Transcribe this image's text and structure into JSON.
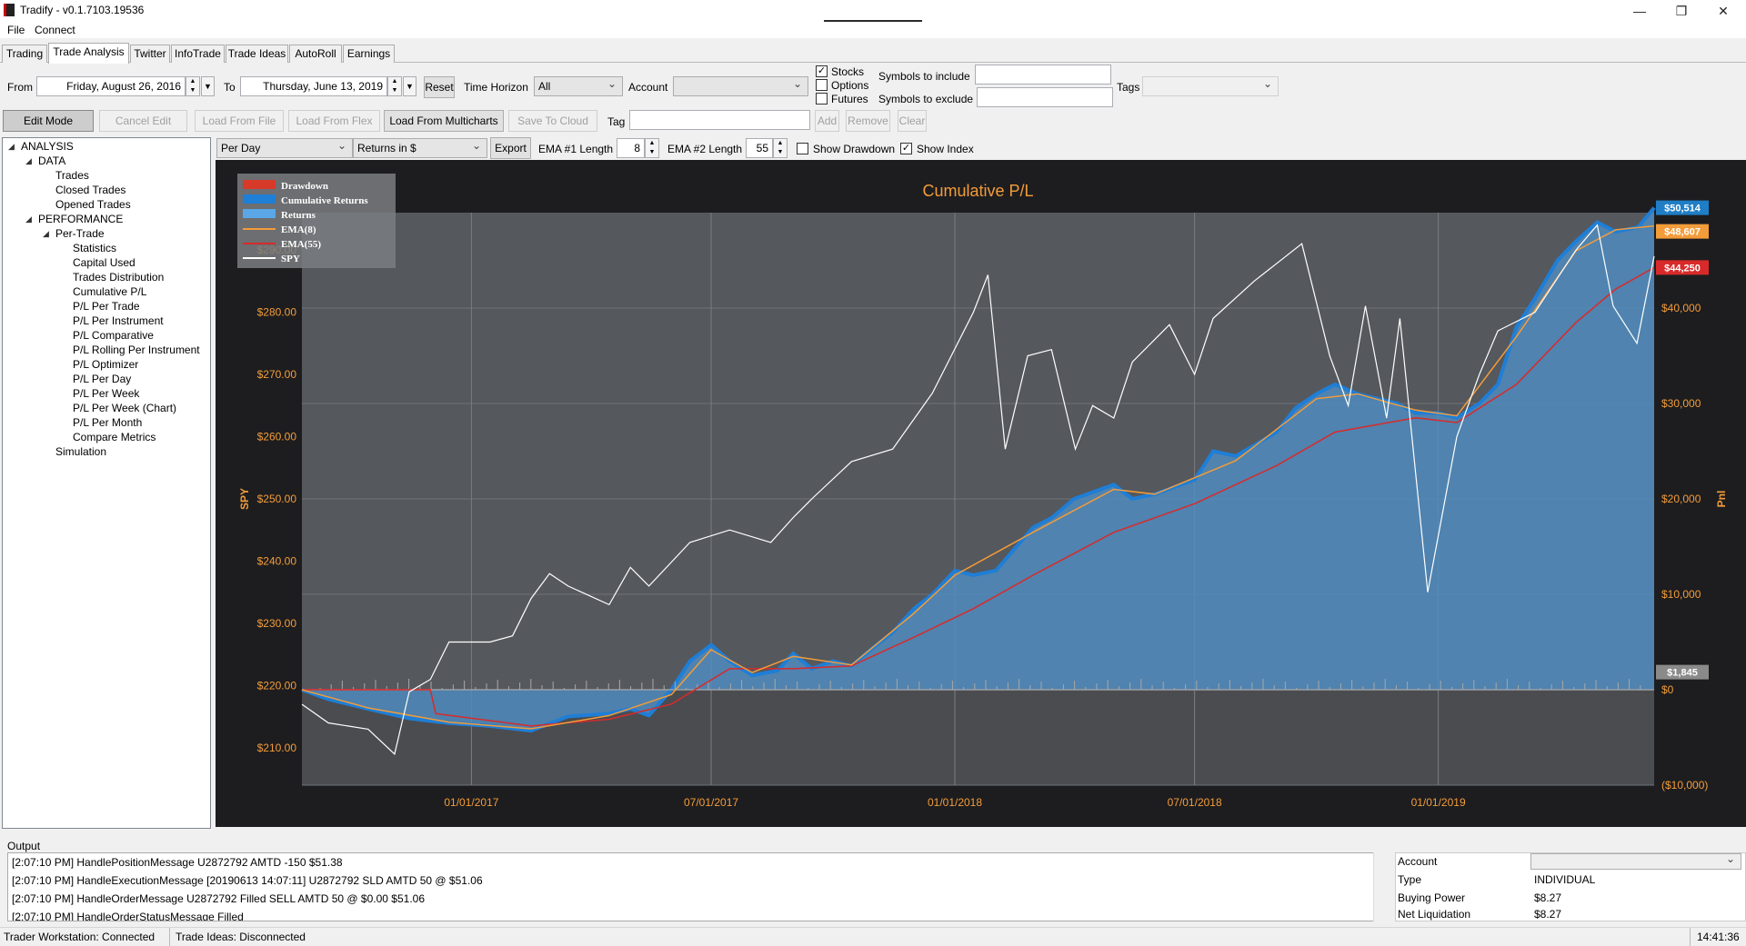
{
  "window": {
    "title": "Tradify - v0.1.7103.19536",
    "minimize": "—",
    "maximize": "❐",
    "close": "✕"
  },
  "menu": [
    "File",
    "Connect"
  ],
  "tabs": [
    "Trading",
    "Trade Analysis",
    "Twitter",
    "InfoTrade",
    "Trade Ideas",
    "AutoRoll",
    "Earnings"
  ],
  "filters": {
    "from_label": "From",
    "from_value": "Friday, August 26, 2016",
    "to_label": "To",
    "to_value": "Thursday, June 13, 2019",
    "reset_label": "Reset",
    "time_horizon_label": "Time Horizon",
    "time_horizon_value": "All",
    "account_label": "Account",
    "account_value": "",
    "stocks_label": "Stocks",
    "options_label": "Options",
    "futures_label": "Futures",
    "stocks_checked": true,
    "options_checked": false,
    "futures_checked": false,
    "include_label": "Symbols to include",
    "exclude_label": "Symbols to exclude",
    "include_value": "",
    "exclude_value": "",
    "tags_label": "Tags",
    "tags_value": ""
  },
  "toolbar": {
    "edit_mode": "Edit Mode",
    "cancel_edit": "Cancel Edit",
    "load_file": "Load From File",
    "load_flex": "Load From Flex",
    "load_multicharts": "Load From Multicharts",
    "save_cloud": "Save To Cloud",
    "tag_label": "Tag",
    "tag_value": "",
    "add": "Add",
    "remove": "Remove",
    "clear": "Clear"
  },
  "chart_options": {
    "period": "Per Day",
    "returns_mode": "Returns in $",
    "export": "Export",
    "ema1_label": "EMA #1 Length",
    "ema1_value": "8",
    "ema2_label": "EMA #2 Length",
    "ema2_value": "55",
    "show_drawdown_label": "Show Drawdown",
    "show_drawdown": false,
    "show_index_label": "Show Index",
    "show_index": true
  },
  "tree": [
    {
      "label": "ANALYSIS",
      "level": 0,
      "expanded": true
    },
    {
      "label": "DATA",
      "level": 1,
      "expanded": true
    },
    {
      "label": "Trades",
      "level": 2
    },
    {
      "label": "Closed Trades",
      "level": 2
    },
    {
      "label": "Opened Trades",
      "level": 2
    },
    {
      "label": "PERFORMANCE",
      "level": 1,
      "expanded": true
    },
    {
      "label": "Per-Trade",
      "level": 2,
      "expanded": true
    },
    {
      "label": "Statistics",
      "level": 3
    },
    {
      "label": "Capital Used",
      "level": 3
    },
    {
      "label": "Trades Distribution",
      "level": 3
    },
    {
      "label": "Cumulative P/L",
      "level": 3
    },
    {
      "label": "P/L Per Trade",
      "level": 3
    },
    {
      "label": "P/L Per Instrument",
      "level": 3
    },
    {
      "label": "P/L Comparative",
      "level": 3
    },
    {
      "label": "P/L Rolling Per Instrument",
      "level": 3
    },
    {
      "label": "P/L Optimizer",
      "level": 3
    },
    {
      "label": "P/L Per Day",
      "level": 3
    },
    {
      "label": "P/L Per Week",
      "level": 3
    },
    {
      "label": "P/L Per Week (Chart)",
      "level": 3
    },
    {
      "label": "P/L Per Month",
      "level": 3
    },
    {
      "label": "Compare Metrics",
      "level": 3
    },
    {
      "label": "Simulation",
      "level": 2
    }
  ],
  "chart_data": {
    "type": "area",
    "title": "Cumulative P/L",
    "ylabel_left": "SPY",
    "ylabel_right": "Pnl",
    "x_tick_labels": [
      "01/01/2017",
      "07/01/2017",
      "01/01/2018",
      "07/01/2018",
      "01/01/2019"
    ],
    "x_range": [
      "2016-08-26",
      "2019-06-13"
    ],
    "y_left_ticks": [
      "$210.00",
      "$220.00",
      "$230.00",
      "$240.00",
      "$250.00",
      "$260.00",
      "$270.00",
      "$280.00",
      "$290.00"
    ],
    "y_left_range": [
      204,
      296
    ],
    "y_right_ticks": [
      "($10,000)",
      "$0",
      "$10,000",
      "$20,000",
      "$30,000",
      "$40,000"
    ],
    "y_right_range": [
      -10000,
      50000
    ],
    "legend": [
      "Drawdown",
      "Cumulative Returns",
      "Returns",
      "EMA(8)",
      "EMA(55)",
      "SPY"
    ],
    "legend_position": "top-left",
    "last_value_labels": [
      {
        "text": "$50,514",
        "color": "#1f7ec6"
      },
      {
        "text": "$48,607",
        "color": "#f39c3a"
      },
      {
        "text": "$44,250",
        "color": "#d82a2a"
      },
      {
        "text": "$1,845",
        "color": "#8a8a8a"
      }
    ],
    "series": [
      {
        "name": "Cumulative Returns",
        "color": "#3d8fd6",
        "points": [
          [
            "2016-08-26",
            0
          ],
          [
            "2016-09-15",
            -1000
          ],
          [
            "2016-10-15",
            -2000
          ],
          [
            "2016-11-15",
            -3000
          ],
          [
            "2016-12-15",
            -3500
          ],
          [
            "2017-01-15",
            -3800
          ],
          [
            "2017-02-15",
            -4300
          ],
          [
            "2017-03-15",
            -2800
          ],
          [
            "2017-04-15",
            -2500
          ],
          [
            "2017-05-01",
            -2000
          ],
          [
            "2017-05-15",
            -2700
          ],
          [
            "2017-06-01",
            0
          ],
          [
            "2017-06-15",
            3000
          ],
          [
            "2017-07-01",
            4700
          ],
          [
            "2017-07-15",
            3000
          ],
          [
            "2017-08-01",
            1500
          ],
          [
            "2017-08-20",
            2000
          ],
          [
            "2017-09-01",
            3800
          ],
          [
            "2017-09-15",
            2200
          ],
          [
            "2017-10-01",
            3000
          ],
          [
            "2017-10-15",
            2500
          ],
          [
            "2017-11-01",
            4500
          ],
          [
            "2017-11-15",
            6000
          ],
          [
            "2017-12-01",
            8500
          ],
          [
            "2017-12-15",
            10000
          ],
          [
            "2018-01-01",
            12500
          ],
          [
            "2018-01-15",
            12000
          ],
          [
            "2018-02-01",
            12500
          ],
          [
            "2018-03-01",
            17000
          ],
          [
            "2018-03-15",
            18000
          ],
          [
            "2018-04-01",
            20000
          ],
          [
            "2018-05-01",
            21500
          ],
          [
            "2018-05-15",
            20000
          ],
          [
            "2018-06-01",
            20500
          ],
          [
            "2018-07-01",
            22000
          ],
          [
            "2018-07-15",
            25000
          ],
          [
            "2018-08-01",
            24500
          ],
          [
            "2018-09-01",
            27000
          ],
          [
            "2018-09-15",
            29500
          ],
          [
            "2018-10-01",
            31000
          ],
          [
            "2018-10-15",
            32000
          ],
          [
            "2018-11-01",
            31000
          ],
          [
            "2018-12-01",
            30000
          ],
          [
            "2018-12-15",
            29000
          ],
          [
            "2019-01-01",
            29000
          ],
          [
            "2019-01-15",
            28500
          ],
          [
            "2019-02-01",
            30000
          ],
          [
            "2019-02-15",
            32000
          ],
          [
            "2019-03-01",
            38000
          ],
          [
            "2019-03-15",
            41000
          ],
          [
            "2019-04-01",
            45000
          ],
          [
            "2019-04-15",
            47000
          ],
          [
            "2019-05-01",
            49000
          ],
          [
            "2019-05-15",
            48000
          ],
          [
            "2019-06-01",
            48500
          ],
          [
            "2019-06-13",
            50514
          ]
        ]
      },
      {
        "name": "EMA(8)",
        "color": "#f39c3a",
        "points": [
          [
            "2016-08-26",
            0
          ],
          [
            "2016-10-15",
            -1900
          ],
          [
            "2016-12-15",
            -3400
          ],
          [
            "2017-02-15",
            -4100
          ],
          [
            "2017-04-15",
            -2700
          ],
          [
            "2017-06-01",
            -500
          ],
          [
            "2017-07-01",
            4200
          ],
          [
            "2017-08-01",
            1800
          ],
          [
            "2017-09-01",
            3500
          ],
          [
            "2017-10-15",
            2600
          ],
          [
            "2017-12-01",
            8000
          ],
          [
            "2018-01-01",
            12000
          ],
          [
            "2018-03-01",
            16500
          ],
          [
            "2018-05-01",
            21000
          ],
          [
            "2018-06-01",
            20500
          ],
          [
            "2018-08-01",
            24000
          ],
          [
            "2018-10-01",
            30500
          ],
          [
            "2018-11-01",
            31000
          ],
          [
            "2018-12-15",
            29300
          ],
          [
            "2019-01-15",
            28700
          ],
          [
            "2019-03-01",
            37000
          ],
          [
            "2019-04-15",
            46000
          ],
          [
            "2019-05-15",
            48200
          ],
          [
            "2019-06-13",
            48607
          ]
        ]
      },
      {
        "name": "EMA(55)",
        "color": "#d82a2a",
        "points": [
          [
            "2016-08-26",
            0
          ],
          [
            "2016-12-01",
            0
          ],
          [
            "2016-12-05",
            -2500
          ],
          [
            "2017-02-15",
            -3800
          ],
          [
            "2017-04-15",
            -3100
          ],
          [
            "2017-06-01",
            -1500
          ],
          [
            "2017-07-15",
            2200
          ],
          [
            "2017-09-01",
            2200
          ],
          [
            "2017-10-15",
            2500
          ],
          [
            "2017-12-01",
            5500
          ],
          [
            "2018-01-15",
            8500
          ],
          [
            "2018-03-01",
            12000
          ],
          [
            "2018-05-01",
            16500
          ],
          [
            "2018-07-01",
            19500
          ],
          [
            "2018-09-01",
            23500
          ],
          [
            "2018-10-15",
            27000
          ],
          [
            "2018-12-15",
            28500
          ],
          [
            "2019-01-15",
            28000
          ],
          [
            "2019-03-01",
            32000
          ],
          [
            "2019-04-15",
            38500
          ],
          [
            "2019-05-15",
            42000
          ],
          [
            "2019-06-13",
            44250
          ]
        ]
      },
      {
        "name": "SPY",
        "color": "#ffffff",
        "points": [
          [
            "2016-08-26",
            217
          ],
          [
            "2016-09-15",
            214
          ],
          [
            "2016-10-15",
            213
          ],
          [
            "2016-11-04",
            209
          ],
          [
            "2016-11-15",
            219
          ],
          [
            "2016-12-01",
            221
          ],
          [
            "2016-12-15",
            227
          ],
          [
            "2017-01-15",
            227
          ],
          [
            "2017-02-01",
            228
          ],
          [
            "2017-02-15",
            234
          ],
          [
            "2017-03-01",
            238
          ],
          [
            "2017-03-15",
            236
          ],
          [
            "2017-04-15",
            233
          ],
          [
            "2017-05-01",
            239
          ],
          [
            "2017-05-15",
            236
          ],
          [
            "2017-06-15",
            243
          ],
          [
            "2017-07-15",
            245
          ],
          [
            "2017-08-15",
            243
          ],
          [
            "2017-09-01",
            247
          ],
          [
            "2017-09-15",
            250
          ],
          [
            "2017-10-15",
            256
          ],
          [
            "2017-11-15",
            258
          ],
          [
            "2017-12-15",
            267
          ],
          [
            "2018-01-15",
            280
          ],
          [
            "2018-01-26",
            286
          ],
          [
            "2018-02-08",
            258
          ],
          [
            "2018-02-25",
            273
          ],
          [
            "2018-03-15",
            274
          ],
          [
            "2018-04-02",
            258
          ],
          [
            "2018-04-15",
            265
          ],
          [
            "2018-05-01",
            263
          ],
          [
            "2018-05-15",
            272
          ],
          [
            "2018-06-12",
            278
          ],
          [
            "2018-07-01",
            270
          ],
          [
            "2018-07-15",
            279
          ],
          [
            "2018-08-15",
            285
          ],
          [
            "2018-09-20",
            291
          ],
          [
            "2018-10-11",
            273
          ],
          [
            "2018-10-25",
            265
          ],
          [
            "2018-11-07",
            281
          ],
          [
            "2018-11-23",
            263
          ],
          [
            "2018-12-03",
            279
          ],
          [
            "2018-12-24",
            235
          ],
          [
            "2019-01-15",
            260
          ],
          [
            "2019-02-01",
            270
          ],
          [
            "2019-02-15",
            277
          ],
          [
            "2019-03-15",
            280
          ],
          [
            "2019-04-15",
            290
          ],
          [
            "2019-05-01",
            294
          ],
          [
            "2019-05-13",
            281
          ],
          [
            "2019-05-31",
            275
          ],
          [
            "2019-06-13",
            289
          ]
        ]
      }
    ]
  },
  "output": {
    "label": "Output",
    "lines": [
      "[2:07:10 PM] HandlePositionMessage U2872792 AMTD -150 $51.38",
      "[2:07:10 PM] HandleExecutionMessage [20190613  14:07:11] U2872792 SLD AMTD 50 @ $51.06",
      "[2:07:10 PM] HandleOrderMessage U2872792 Filled SELL AMTD 50 @ $0.00 $51.06",
      "[2:07:10 PM] HandleOrderStatusMessage Filled"
    ]
  },
  "account_info": {
    "account_label": "Account",
    "account_value": "",
    "type_label": "Type",
    "type_value": "INDIVIDUAL",
    "buying_power_label": "Buying Power",
    "buying_power_value": "$8.27",
    "net_liq_label": "Net Liquidation",
    "net_liq_value": "$8.27"
  },
  "status": {
    "tws": "Trader Workstation: Connected",
    "trade_ideas": "Trade Ideas: Disconnected",
    "clock": "14:41:36"
  }
}
